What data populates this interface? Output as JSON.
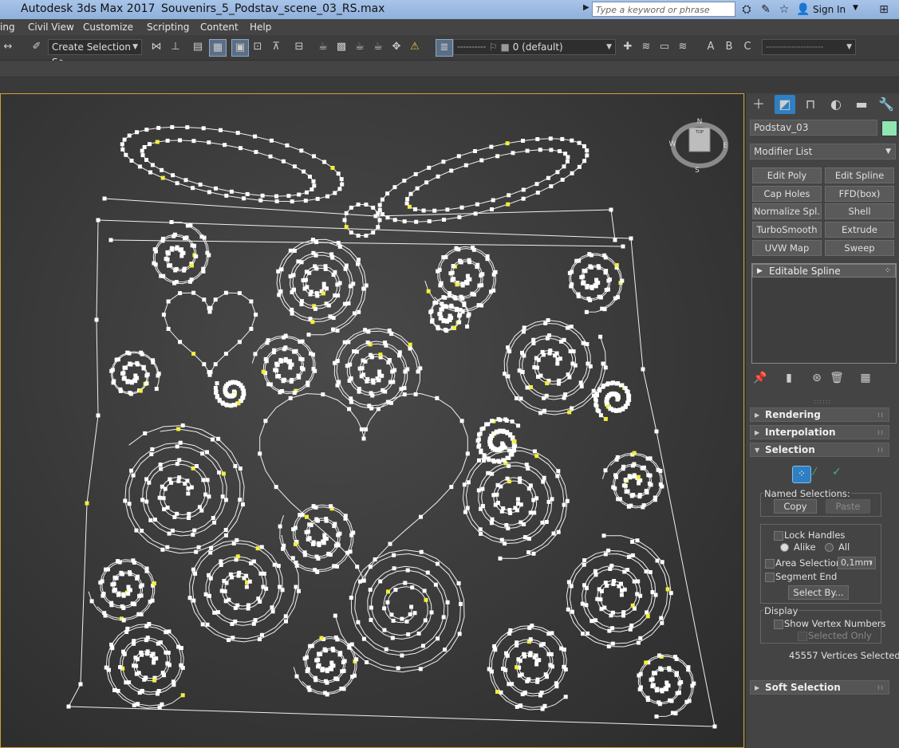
{
  "titlebar": {
    "app": "Autodesk 3ds Max 2017",
    "file": "Souvenirs_5_Podstav_scene_03_RS.max",
    "search_placeholder": "Type a keyword or phrase",
    "sign_in": "Sign In"
  },
  "menu": [
    "ing",
    "Civil View",
    "Customize",
    "Scripting",
    "Content",
    "Help"
  ],
  "toolbar": {
    "selection_set": "Create Selection Se",
    "layer": "0 (default)"
  },
  "command_panel": {
    "object_name": "Podstav_03",
    "object_color": "#8fe6b3",
    "modifier_list": "Modifier List",
    "modifier_buttons": [
      "Edit Poly",
      "Edit Spline",
      "Cap Holes",
      "FFD(box)",
      "Normalize Spl.",
      "Shell",
      "TurboSmooth",
      "Extrude",
      "UVW Map",
      "Sweep"
    ],
    "stack_item": "Editable Spline",
    "rollouts": {
      "rendering": "Rendering",
      "interpolation": "Interpolation",
      "selection": "Selection",
      "soft_selection": "Soft Selection"
    },
    "selection": {
      "named_selections": "Named Selections:",
      "copy": "Copy",
      "paste": "Paste",
      "lock_handles": "Lock Handles",
      "alike": "Alike",
      "all": "All",
      "area_selection": "Area Selection:",
      "area_value": "0,1mm",
      "segment_end": "Segment End",
      "select_by": "Select By...",
      "display": "Display",
      "show_vertex_numbers": "Show Vertex Numbers",
      "selected_only": "Selected Only",
      "status": "45557 Vertices Selected"
    }
  },
  "viewcube": {
    "face": "TOP",
    "north": "N",
    "south": "S",
    "east": "E",
    "west": "W"
  }
}
